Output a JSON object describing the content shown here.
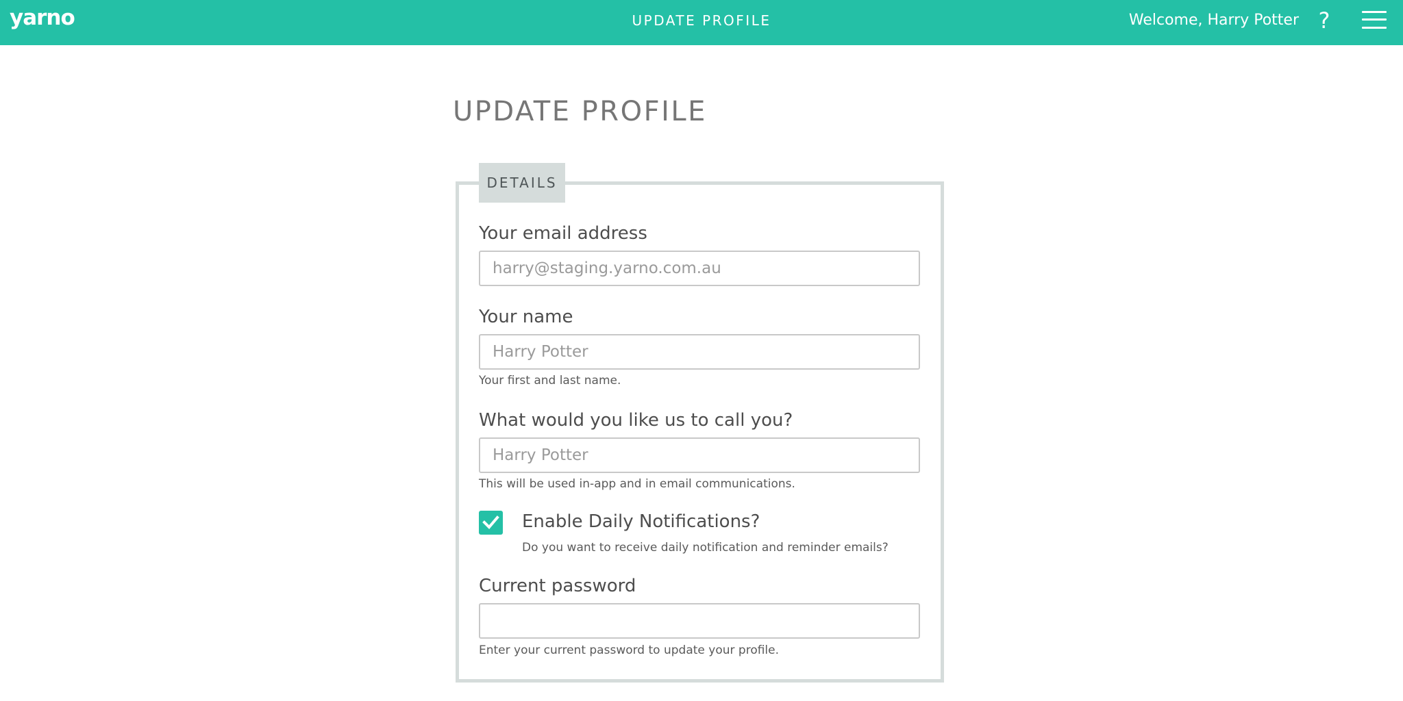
{
  "header": {
    "logo": "yarno",
    "title": "UPDATE PROFILE",
    "welcome": "Welcome, Harry Potter",
    "help_icon": "help-icon",
    "menu_icon": "hamburger-menu-icon",
    "background_color": "#24c0a6"
  },
  "page": {
    "title": "UPDATE PROFILE"
  },
  "details": {
    "legend": "DETAILS",
    "email": {
      "label": "Your email address",
      "placeholder": "harry@staging.yarno.com.au"
    },
    "name": {
      "label": "Your name",
      "placeholder": "Harry Potter",
      "hint": "Your first and last name."
    },
    "nickname": {
      "label": "What would you like us to call you?",
      "placeholder": "Harry Potter",
      "hint": "This will be used in-app and in email communications."
    },
    "notifications": {
      "label": "Enable Daily Notifications?",
      "hint": "Do you want to receive daily notification and reminder emails?",
      "checked": true,
      "icon": "checkmark-icon"
    },
    "password": {
      "label": "Current password",
      "value": "",
      "hint": "Enter your current password to update your profile."
    }
  }
}
